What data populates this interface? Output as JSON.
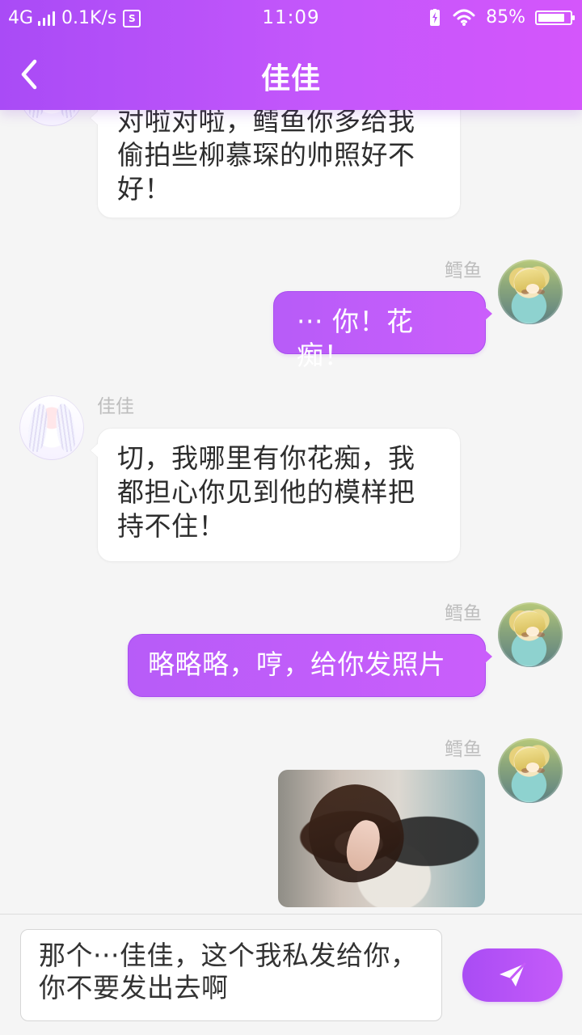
{
  "status_bar": {
    "network": "4G",
    "speed": "0.1K/s",
    "time": "11:09",
    "battery_percent": "85%",
    "battery_level": 0.85
  },
  "header": {
    "title": "佳佳",
    "back_icon": "back-arrow-icon"
  },
  "chat": {
    "messages": [
      {
        "sender": "",
        "text": "对啦对啦，鳕鱼你多给我偷拍些柳慕琛的帅照好不好！"
      },
      {
        "sender": "鳕鱼",
        "text": "··· 你！花痴！"
      },
      {
        "sender": "佳佳",
        "text": "切，我哪里有你花痴，我都担心你见到他的模样把持不住！"
      },
      {
        "sender": "鳕鱼",
        "text": "略略略，哼，给你发照片"
      },
      {
        "sender": "鳕鱼",
        "image": "photo-message"
      }
    ]
  },
  "composer": {
    "input_value": "那个···佳佳，这个我私发给你，你不要发出去啊",
    "send_icon": "send-icon"
  },
  "colors": {
    "accent_start": "#a94bf6",
    "accent_end": "#d456fb",
    "outgoing_bubble": "#c45cf9",
    "incoming_bubble": "#ffffff",
    "background": "#f5f5f5"
  }
}
